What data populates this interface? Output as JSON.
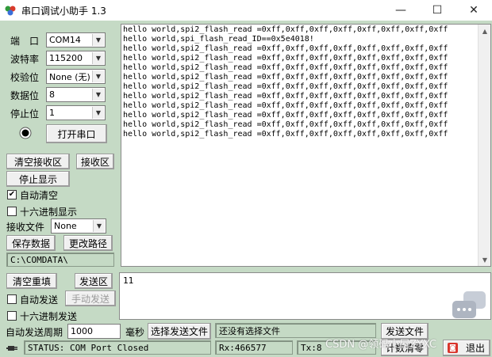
{
  "window": {
    "title": "串口调试小助手 1.3",
    "controls": [
      "—",
      "☐",
      "✕"
    ]
  },
  "serial": {
    "port_label": "端　口",
    "port_value": "COM14",
    "baud_label": "波特率",
    "baud_value": "115200",
    "parity_label": "校验位",
    "parity_value": "None (无)",
    "databits_label": "数据位",
    "databits_value": "8",
    "stopbits_label": "停止位",
    "stopbits_value": "1",
    "open_button": "打开串口",
    "status_indicator_color": "#000000"
  },
  "receive": {
    "clear_button": "清空接收区",
    "area_button": "接收区",
    "stop_display_button": "停止显示",
    "auto_clear_label": "自动清空",
    "auto_clear_checked": true,
    "hex_display_label": "十六进制显示",
    "hex_display_checked": false,
    "file_label": "接收文件",
    "file_format": "None",
    "save_data_button": "保存数据",
    "change_path_button": "更改路径",
    "path": "C:\\COMDATA\\",
    "lines": [
      "hello world,spi2_flash_read =0xff,0xff,0xff,0xff,0xff,0xff,0xff,0xff",
      "hello world,spi_flash_read_ID==0x5e4018!",
      "hello world,spi2_flash_read =0xff,0xff,0xff,0xff,0xff,0xff,0xff,0xff",
      "hello world,spi2_flash_read =0xff,0xff,0xff,0xff,0xff,0xff,0xff,0xff",
      "hello world,spi2_flash_read =0xff,0xff,0xff,0xff,0xff,0xff,0xff,0xff",
      "hello world,spi2_flash_read =0xff,0xff,0xff,0xff,0xff,0xff,0xff,0xff",
      "hello world,spi2_flash_read =0xff,0xff,0xff,0xff,0xff,0xff,0xff,0xff",
      "hello world,spi2_flash_read =0xff,0xff,0xff,0xff,0xff,0xff,0xff,0xff",
      "hello world,spi2_flash_read =0xff,0xff,0xff,0xff,0xff,0xff,0xff,0xff",
      "hello world,spi2_flash_read =0xff,0xff,0xff,0xff,0xff,0xff,0xff,0xff",
      "hello world,spi2_flash_read =0xff,0xff,0xff,0xff,0xff,0xff,0xff,0xff",
      "hello world,spi2_flash_read =0xff,0xff,0xff,0xff,0xff,0xff,0xff,0xff"
    ]
  },
  "send": {
    "clear_button": "清空重填",
    "area_button": "发送区",
    "auto_send_label": "自动发送",
    "auto_send_checked": false,
    "manual_send_button": "手动发送",
    "hex_send_label": "十六进制发送",
    "hex_send_checked": false,
    "period_label": "自动发送周期",
    "period_value": "1000",
    "period_unit": "毫秒",
    "select_file_button": "选择发送文件",
    "file_status": "还没有选择文件",
    "send_file_button": "发送文件",
    "text": "11"
  },
  "statusbar": {
    "status": "STATUS: COM Port Closed",
    "rx": "Rx:466577",
    "tx": "Tx:8",
    "count_clear_button": "计数清零",
    "exit_button": "退出"
  },
  "watermark": "CSDN @领码小屋ZYXC",
  "colors": {
    "client_bg": "#c5dac5",
    "button_bg": "#f0f0f0"
  }
}
